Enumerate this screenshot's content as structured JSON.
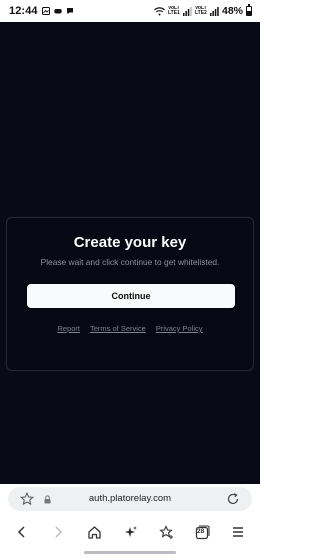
{
  "status_bar": {
    "time": "12:44",
    "volte1": "VoLTE LTE1",
    "volte2": "VoLTE LTE2",
    "battery": "48%"
  },
  "card": {
    "title": "Create your key",
    "subtitle": "Please wait and click continue to get whitelisted.",
    "continue_label": "Continue",
    "links": [
      "Report",
      "Terms of Service",
      "Privacy Policy"
    ]
  },
  "browser": {
    "url": "auth.platorelay.com",
    "tab_count": "28"
  },
  "colors": {
    "page_background": "#080b15",
    "card_border": "#252a36",
    "button_bg": "#f9fafb"
  }
}
